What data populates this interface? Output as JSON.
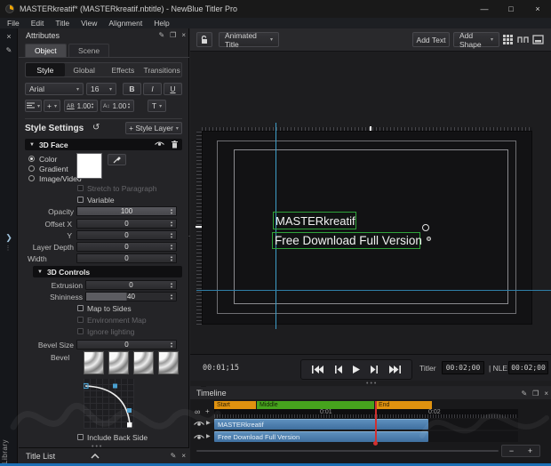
{
  "window": {
    "title": "MASTERkreatif* (MASTERkreatif.nbtitle) - NewBlue Titler Pro",
    "menus": [
      "File",
      "Edit",
      "Title",
      "View",
      "Alignment",
      "Help"
    ]
  },
  "attributes": {
    "title": "Attributes",
    "tabs": [
      "Object",
      "Scene"
    ],
    "subtabs": [
      "Style",
      "Global",
      "Effects",
      "Transitions"
    ],
    "font": {
      "family": "Arial",
      "size": "16",
      "bold": "B",
      "italic": "I",
      "underline": "U"
    },
    "spacing": {
      "tracking_icon": "AB",
      "tracking": "1.00",
      "leading_icon": "A↕",
      "leading": "1.00",
      "t_icon": "T"
    },
    "style_settings": {
      "title": "Style Settings",
      "add_layer": "+ Style Layer"
    },
    "face": {
      "title": "3D Face",
      "modes": [
        "Color",
        "Gradient",
        "Image/Video"
      ],
      "checkboxes": [
        "Stretch to Paragraph",
        "Variable"
      ],
      "rows": [
        {
          "label": "Opacity",
          "value": "100"
        },
        {
          "label": "Offset",
          "sub": "X",
          "value": "0"
        },
        {
          "sub": "Y",
          "value": "0"
        },
        {
          "label": "Layer Depth",
          "value": "0"
        },
        {
          "label": "Width",
          "value": "0"
        }
      ]
    },
    "controls3d": {
      "title": "3D Controls",
      "rows": [
        {
          "label": "Extrusion",
          "value": "0"
        },
        {
          "label": "Shininess",
          "value": "40"
        },
        {
          "label": "Bevel Size",
          "value": "0"
        }
      ],
      "checkboxes": [
        "Map to Sides",
        "Environment Map",
        "Ignore lighting"
      ],
      "bevel_label": "Bevel",
      "include_back": "Include Back Side"
    },
    "title_list": "Title List",
    "library_label": "Library"
  },
  "canvas": {
    "template": "Animated Title",
    "add_text": "Add Text",
    "add_shape": "Add Shape",
    "text1": "MASTERkreatif",
    "text2": "Free Download Full Version"
  },
  "transport": {
    "current": "00:01;15",
    "titler_label": "Titler",
    "titler_time": "00:02;00",
    "nle_label": "| NLE",
    "nle_time": "00:02;00"
  },
  "timeline": {
    "title": "Timeline",
    "segments": [
      {
        "label": "Start",
        "color": "#e0920f"
      },
      {
        "label": "Middle",
        "color": "#46a31d"
      },
      {
        "label": "End",
        "color": "#e0920f"
      }
    ],
    "ruler": [
      "0:01",
      "0:02"
    ],
    "tracks": [
      "MASTERkreatif",
      "Free Download Full Version"
    ],
    "zoom_out": "−",
    "zoom_in": "+"
  },
  "icons": {
    "close": "×",
    "minimize": "—",
    "maximize": "□",
    "pen": "✎",
    "popout": "❐",
    "undo": "↺",
    "caretdown": "▾",
    "caretdown2": "▼",
    "triright": "▶",
    "up": "▴",
    "down": "▾",
    "plus": "+",
    "infinity": "∞",
    "chevright": "❯",
    "dotsv": "⋮",
    "dotsh": "•••"
  },
  "colors": {
    "accent_blue_guide": "#3e9dc8",
    "selection_green": "#2fa33a",
    "segment_orange": "#e0920f",
    "segment_green": "#46a31d",
    "clip_blue": "#4a7fae",
    "playhead_red": "#d23030",
    "window_border_blue": "#1b6fb5",
    "panel_bg": "#242427",
    "stage_bg": "#1d1d1f"
  }
}
